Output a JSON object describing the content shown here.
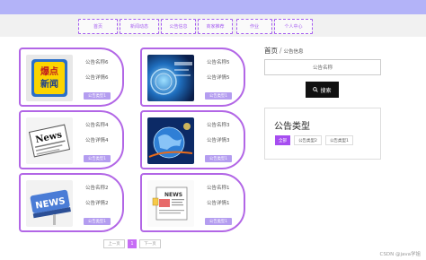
{
  "nav": {
    "items": [
      "首页",
      "新闻动态",
      "公告信息",
      "商家推荐",
      "作业",
      "个人中心"
    ]
  },
  "cards": [
    {
      "title": "公告名称6",
      "detail": "公告详情6",
      "type": "公告类型1",
      "image": "news-badge-image"
    },
    {
      "title": "公告名称5",
      "detail": "公告详情5",
      "type": "公告类型1",
      "image": "digital-news-image"
    },
    {
      "title": "公告名称4",
      "detail": "公告详情4",
      "type": "公告类型1",
      "image": "newspaper-image"
    },
    {
      "title": "公告名称3",
      "detail": "公告详情3",
      "type": "公告类型1",
      "image": "globe-image"
    },
    {
      "title": "公告名称2",
      "detail": "公告详情2",
      "type": "公告类型1",
      "image": "news-3d-image"
    },
    {
      "title": "公告名称1",
      "detail": "公告详情1",
      "type": "公告类型1",
      "image": "news-paper-sketch-image"
    }
  ],
  "sidebar": {
    "breadcrumb_home": "首页",
    "breadcrumb_sep": "/",
    "breadcrumb_current": "公告信息",
    "search_placeholder": "公告名称",
    "search_button": "搜索",
    "type_heading": "公告类型",
    "type_tags": [
      "全部",
      "公告类型2",
      "公告类型1"
    ]
  },
  "pager": {
    "prev": "上一页",
    "page": "1",
    "next": "下一页"
  },
  "watermark": "CSDN @java学姐",
  "colors": {
    "accent": "#a55df0",
    "topbar": "#b3b3f8",
    "tag_active": "#a64df0",
    "type_badge": "#b49df0"
  }
}
